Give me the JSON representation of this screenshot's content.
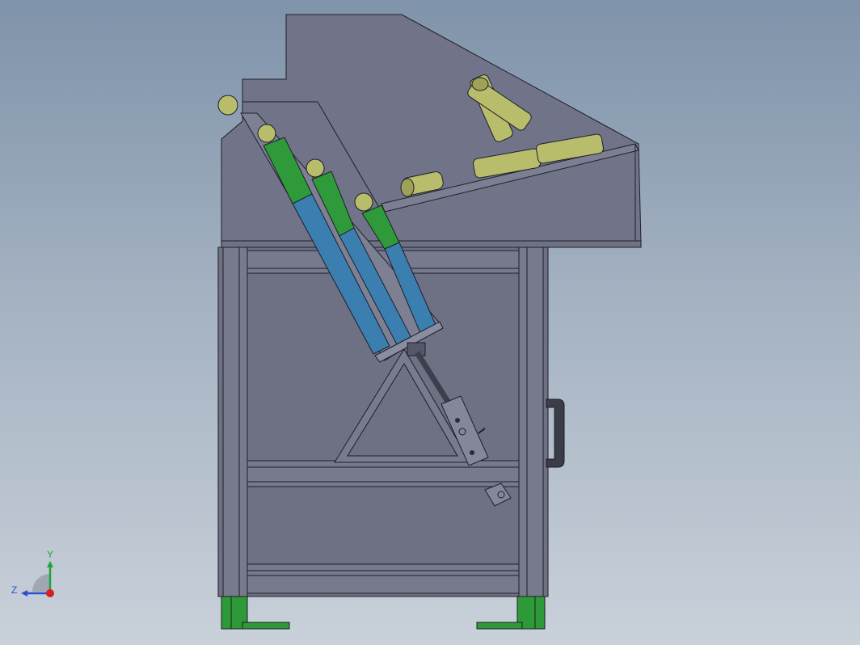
{
  "viewport": {
    "background_top": "#7f93aa",
    "background_bottom": "#c9d1da"
  },
  "colors": {
    "sheet_metal": "#717488",
    "frame": "#737688",
    "edge": "#1e1e28",
    "chute_green": "#2f9a3a",
    "chute_blue": "#3a7fb0",
    "tube_olive": "#b8bd6c",
    "foot_green": "#2e9a37",
    "handle": "#3a3c48",
    "axis_x": "#d81e1e",
    "axis_y": "#1fa33a",
    "axis_z": "#2a4fd0"
  },
  "triad": {
    "y_label": "Y",
    "z_label": "Z",
    "icon": "axis-triad-icon"
  }
}
